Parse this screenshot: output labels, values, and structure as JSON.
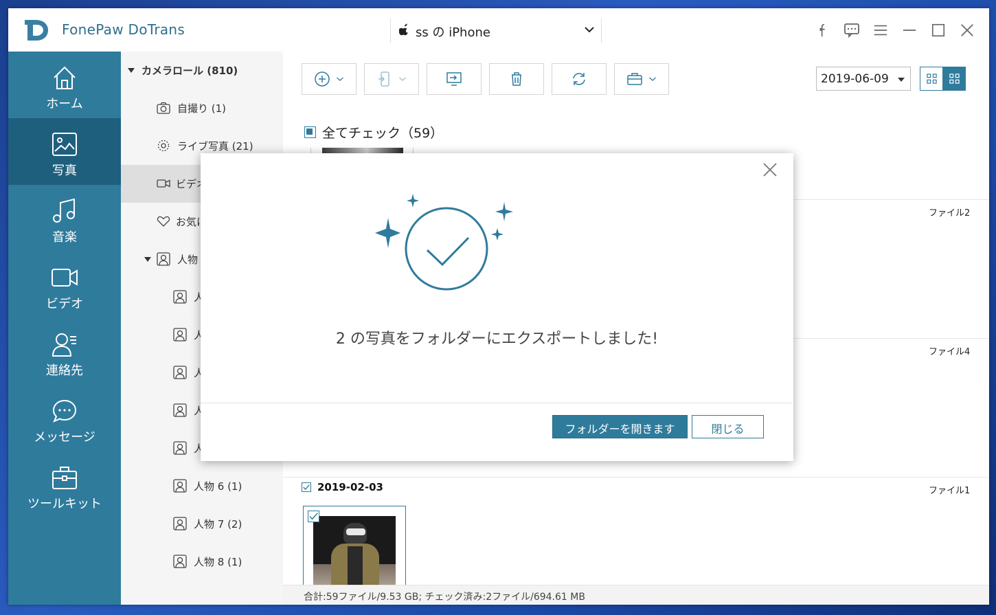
{
  "app": {
    "title": "FonePaw DoTrans"
  },
  "device": {
    "name": "ss の iPhone"
  },
  "colors": {
    "accent": "#2f7b9c",
    "sidebar": "#2f7b9c",
    "sidebar_active": "#1f5f7e"
  },
  "sidebar": {
    "items": [
      {
        "label": "ホーム",
        "icon": "home-icon"
      },
      {
        "label": "写真",
        "icon": "photo-icon"
      },
      {
        "label": "音楽",
        "icon": "music-icon"
      },
      {
        "label": "ビデオ",
        "icon": "video-icon"
      },
      {
        "label": "連絡先",
        "icon": "contacts-icon"
      },
      {
        "label": "メッセージ",
        "icon": "message-icon"
      },
      {
        "label": "ツールキット",
        "icon": "toolkit-icon"
      }
    ]
  },
  "tree": {
    "camera_roll": "カメラロール (810)",
    "selfie": "自撮り (1)",
    "live": "ライブ写真 (21)",
    "video": "ビデオ",
    "favorites": "お気に",
    "people": "人物",
    "person_partial": "人",
    "person6": "人物 6 (1)",
    "person7": "人物 7 (2)",
    "person8": "人物 8 (1)"
  },
  "toolbar": {
    "date": "2019-06-09"
  },
  "content": {
    "check_all": "全てチェック（59）",
    "file2": "ファイル2",
    "file4": "ファイル4",
    "file1": "ファイル1",
    "group_date": "2019-02-03"
  },
  "status": {
    "text": "合計:59ファイル/9.53 GB; チェック済み:2ファイル/694.61 MB"
  },
  "dialog": {
    "message": "2 の写真をフォルダーにエクスポートしました!",
    "open_folder": "フォルダーを開きます",
    "close": "閉じる"
  }
}
